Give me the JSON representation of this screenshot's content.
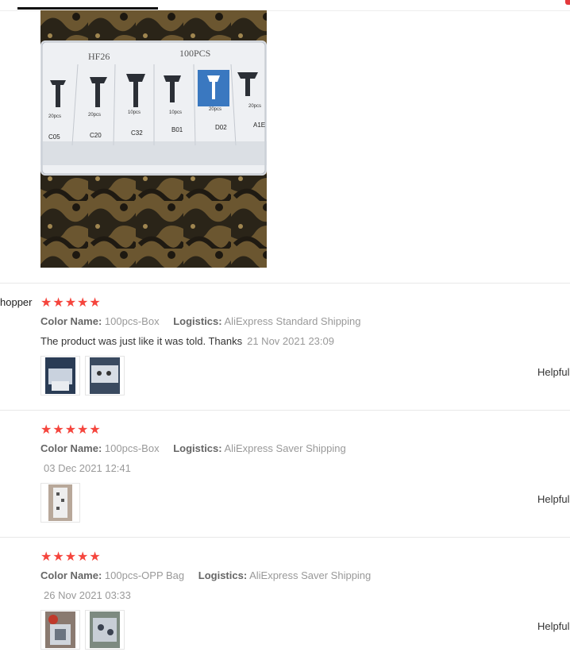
{
  "header": {
    "accent_color": "#111111",
    "corner_color": "#e4393c"
  },
  "photo": {
    "box_label_left": "HF26",
    "box_label_right": "100PCS",
    "compartments": [
      {
        "qty": "20pcs",
        "code": "C05"
      },
      {
        "qty": "20pcs",
        "code": "C20"
      },
      {
        "qty": "10pcs",
        "code": "C32"
      },
      {
        "qty": "10pcs",
        "code": "B01"
      },
      {
        "qty": "20pcs",
        "code": "D02"
      },
      {
        "qty": "20pcs",
        "code": "A1E"
      }
    ]
  },
  "reviews": [
    {
      "user": "hopper",
      "stars": "★★★★★",
      "color_label": "Color Name:",
      "color_value": "100pcs-Box",
      "logistics_label": "Logistics:",
      "logistics_value": "AliExpress Standard Shipping",
      "text": "The product was just like it was told. Thanks",
      "date": "21 Nov 2021 23:09",
      "helpful": "Helpful"
    },
    {
      "stars": "★★★★★",
      "color_label": "Color Name:",
      "color_value": "100pcs-Box",
      "logistics_label": "Logistics:",
      "logistics_value": "AliExpress Saver Shipping",
      "date": "03 Dec 2021 12:41",
      "helpful": "Helpful"
    },
    {
      "stars": "★★★★★",
      "color_label": "Color Name:",
      "color_value": "100pcs-OPP Bag",
      "logistics_label": "Logistics:",
      "logistics_value": "AliExpress Saver Shipping",
      "date": "26 Nov 2021 03:33",
      "helpful": "Helpful"
    }
  ]
}
